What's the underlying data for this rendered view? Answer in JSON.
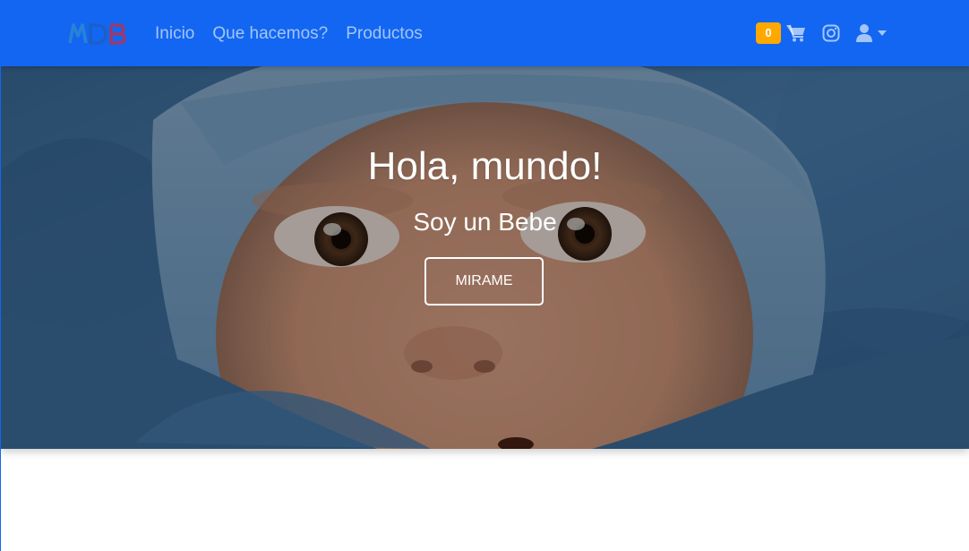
{
  "navbar": {
    "brand_text": "MDB",
    "links": [
      "Inicio",
      "Que hacemos?",
      "Productos"
    ],
    "cart_count": "0",
    "icons": [
      "shopping-cart-icon",
      "instagram-icon",
      "user-icon",
      "caret-down-icon"
    ]
  },
  "hero": {
    "title": "Hola, mundo!",
    "subtitle": "Soy un Bebe",
    "button_label": "MIRAME"
  },
  "colors": {
    "navbar": "#1266f1",
    "badge": "#ffa900",
    "white": "#ffffff"
  }
}
